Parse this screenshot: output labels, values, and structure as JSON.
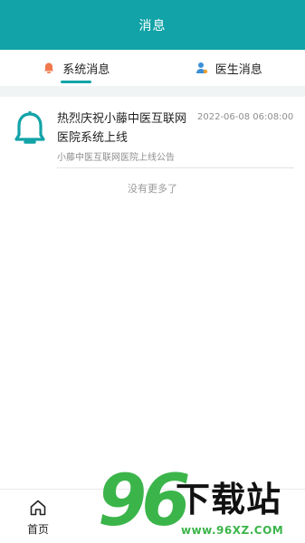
{
  "header": {
    "title": "消息"
  },
  "tabs": [
    {
      "label": "系统消息",
      "icon": "bell-icon",
      "active": true
    },
    {
      "label": "医生消息",
      "icon": "doctor-user-icon",
      "active": false
    }
  ],
  "messages": [
    {
      "title": "热烈庆祝小藤中医互联网医院系统上线",
      "time": "2022-06-08 06:08:00",
      "summary": "小藤中医互联网医院上线公告",
      "icon": "bell-outline-icon"
    }
  ],
  "list_footer": "没有更多了",
  "bottom_nav": {
    "home_label": "首页",
    "home_icon": "home-icon"
  },
  "watermark": {
    "number": "96",
    "text": "下载站",
    "url": "www.96XZ.COM"
  },
  "colors": {
    "primary": "#12a3a8",
    "tab_bell": "#f0784a",
    "tab_doctor": "#3a8fd6",
    "watermark_green": "#3bb54a"
  }
}
